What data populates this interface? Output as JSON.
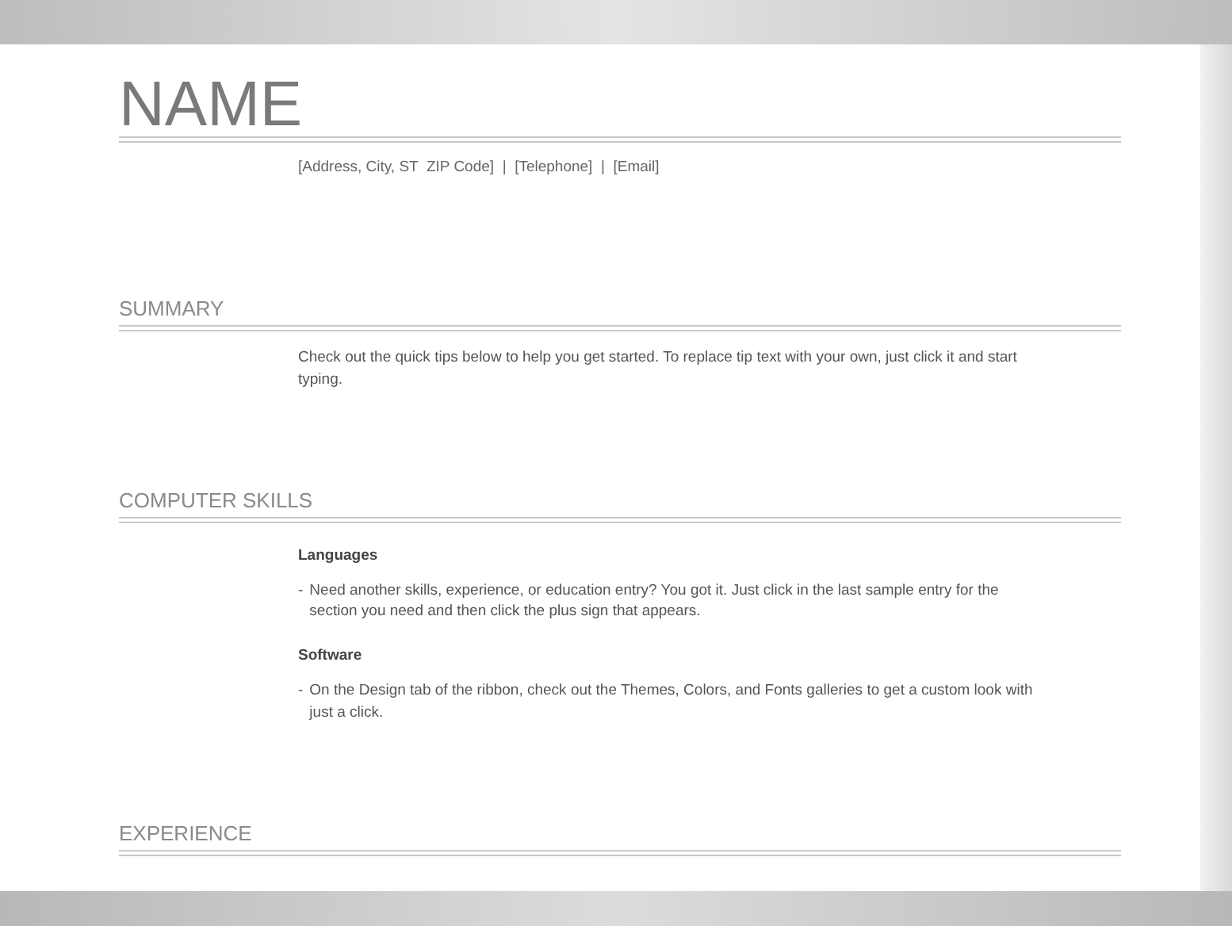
{
  "name": "NAME",
  "contact": "[Address, City, ST  ZIP Code]  |  [Telephone]  |  [Email]",
  "sections": [
    {
      "heading": "SUMMARY",
      "entries": [
        {
          "kind": "paragraph",
          "text": "Check out the quick tips below to help you get started. To replace tip text with your own, just click it and start typing."
        }
      ]
    },
    {
      "heading": "COMPUTER SKILLS",
      "entries": [
        {
          "kind": "subheading",
          "text": "Languages"
        },
        {
          "kind": "bullet",
          "marker": "-",
          "text": "Need another skills, experience, or education entry? You got it. Just click in the last sample entry for the section you need and then click the plus sign that appears."
        },
        {
          "kind": "subheading",
          "text": "Software"
        },
        {
          "kind": "bullet",
          "marker": "-",
          "text": "On the Design tab of the ribbon, check out the Themes, Colors, and Fonts galleries to get a custom look with just a click."
        }
      ]
    },
    {
      "heading": "EXPERIENCE"
    }
  ]
}
